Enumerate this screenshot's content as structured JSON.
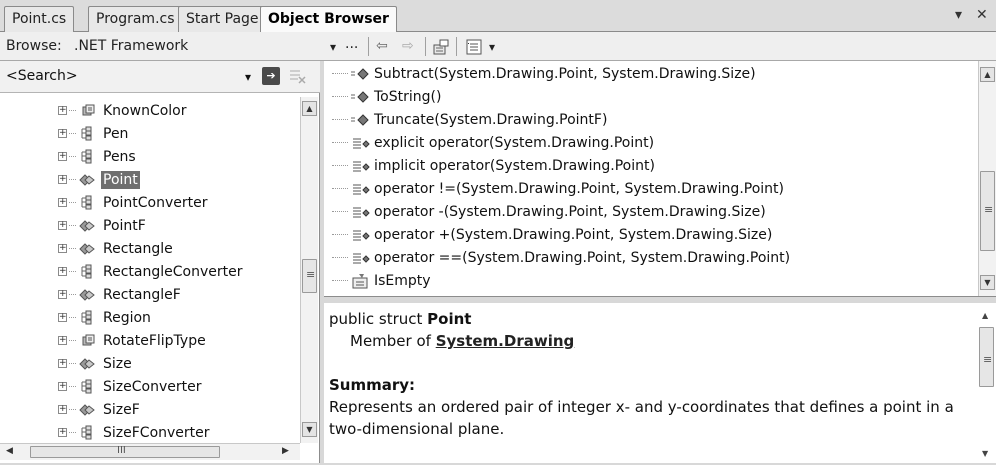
{
  "tabs": [
    {
      "label": "Point.cs",
      "active": false
    },
    {
      "label": "Program.cs",
      "active": false
    },
    {
      "label": "Start Page",
      "active": false
    },
    {
      "label": "Object Browser",
      "active": true
    }
  ],
  "window_controls": {
    "dropdown_icon": "chevron-down-icon",
    "close_icon": "close-icon",
    "dropdown_glyph": "▾",
    "close_glyph": "✕"
  },
  "toolbar": {
    "browse_label": "Browse:",
    "browse_value": ".NET Framework",
    "browse_dropdown_glyph": "▾",
    "ellipsis": "...",
    "back_glyph": "⇦",
    "forward_glyph": "⇨",
    "settings_dropdown_glyph": "▾"
  },
  "search": {
    "placeholder": "<Search>",
    "dropdown_glyph": "▾",
    "go_glyph": "➔"
  },
  "tree": {
    "items": [
      {
        "label": "KnownColor",
        "icon": "enum-icon",
        "selected": false
      },
      {
        "label": "Pen",
        "icon": "class-icon",
        "selected": false
      },
      {
        "label": "Pens",
        "icon": "class-icon",
        "selected": false
      },
      {
        "label": "Point",
        "icon": "struct-icon",
        "selected": true
      },
      {
        "label": "PointConverter",
        "icon": "class-icon",
        "selected": false
      },
      {
        "label": "PointF",
        "icon": "struct-icon",
        "selected": false
      },
      {
        "label": "Rectangle",
        "icon": "struct-icon",
        "selected": false
      },
      {
        "label": "RectangleConverter",
        "icon": "class-icon",
        "selected": false
      },
      {
        "label": "RectangleF",
        "icon": "struct-icon",
        "selected": false
      },
      {
        "label": "Region",
        "icon": "class-icon",
        "selected": false
      },
      {
        "label": "RotateFlipType",
        "icon": "enum-icon",
        "selected": false
      },
      {
        "label": "Size",
        "icon": "struct-icon",
        "selected": false
      },
      {
        "label": "SizeConverter",
        "icon": "class-icon",
        "selected": false
      },
      {
        "label": "SizeF",
        "icon": "struct-icon",
        "selected": false
      },
      {
        "label": "SizeFConverter",
        "icon": "class-icon",
        "selected": false
      }
    ],
    "hscroll_glyph": "III"
  },
  "members": {
    "items": [
      {
        "label": "Subtract(System.Drawing.Point, System.Drawing.Size)",
        "icon": "method-icon"
      },
      {
        "label": "ToString()",
        "icon": "method-icon"
      },
      {
        "label": "Truncate(System.Drawing.PointF)",
        "icon": "method-icon"
      },
      {
        "label": "explicit operator(System.Drawing.Point)",
        "icon": "operator-icon"
      },
      {
        "label": "implicit operator(System.Drawing.Point)",
        "icon": "operator-icon"
      },
      {
        "label": "operator !=(System.Drawing.Point, System.Drawing.Point)",
        "icon": "operator-icon"
      },
      {
        "label": "operator -(System.Drawing.Point, System.Drawing.Size)",
        "icon": "operator-icon"
      },
      {
        "label": "operator +(System.Drawing.Point, System.Drawing.Size)",
        "icon": "operator-icon"
      },
      {
        "label": "operator ==(System.Drawing.Point, System.Drawing.Point)",
        "icon": "operator-icon"
      },
      {
        "label": "IsEmpty",
        "icon": "property-icon"
      }
    ]
  },
  "description": {
    "signature_prefix": "public struct ",
    "signature_name": "Point",
    "member_of_prefix": "Member of ",
    "member_of_link": "System.Drawing",
    "summary_heading": "Summary:",
    "summary_line1": "Represents an ordered pair of integer x- and y-coordinates that defines a point in a",
    "summary_line2": "two-dimensional plane."
  },
  "scroll_glyphs": {
    "up": "▲",
    "down": "▼",
    "left": "◀",
    "right": "▶",
    "grip": "≡"
  }
}
